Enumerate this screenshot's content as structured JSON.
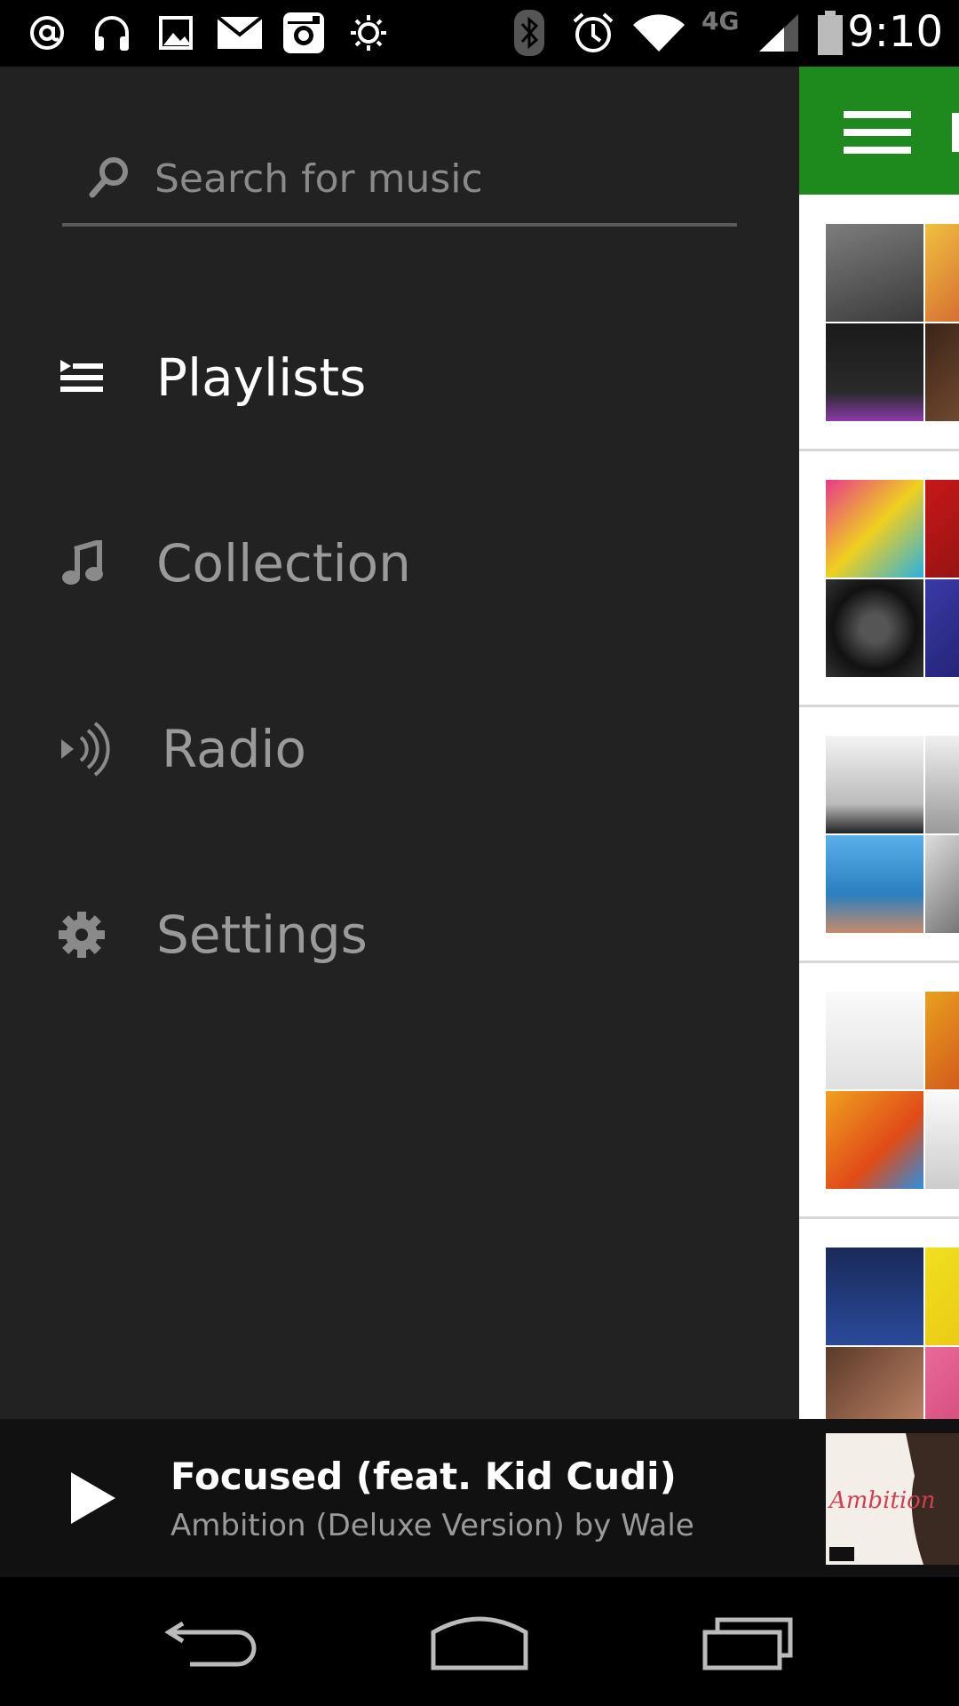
{
  "status_bar": {
    "time": "9:10",
    "network_label": "4G",
    "icons": [
      "at-icon",
      "headphones-icon",
      "image-icon",
      "mail-icon",
      "instagram-icon",
      "brightness-icon",
      "bluetooth-icon",
      "alarm-icon",
      "wifi-icon",
      "signal-icon",
      "battery-icon"
    ]
  },
  "search": {
    "placeholder": "Search for music"
  },
  "nav": {
    "items": [
      {
        "label": "Playlists",
        "icon": "playlists-icon",
        "active": true
      },
      {
        "label": "Collection",
        "icon": "music-note-icon",
        "active": false
      },
      {
        "label": "Radio",
        "icon": "radio-icon",
        "active": false
      },
      {
        "label": "Settings",
        "icon": "gear-icon",
        "active": false
      }
    ]
  },
  "now_playing": {
    "title": "Focused (feat. Kid Cudi)",
    "subtitle": "Ambition (Deluxe Version) by Wale",
    "art_text": "Ambition"
  },
  "colors": {
    "drawer_bg": "#222222",
    "accent_green": "#1e8a1e",
    "active_text": "#ffffff",
    "inactive_text": "#9a9a9a"
  }
}
